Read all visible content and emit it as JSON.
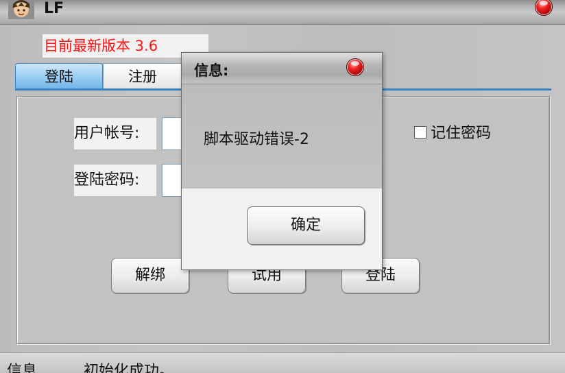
{
  "window": {
    "title": "LF",
    "logo_icon": "app-avatar-icon",
    "close_icon": "red-orb-close-icon"
  },
  "version": {
    "text": "目前最新版本 3.6",
    "color": "#ff1414"
  },
  "tabs": [
    {
      "label": "登陆",
      "active": true
    },
    {
      "label": "注册",
      "active": false
    }
  ],
  "form": {
    "account_label": "用户帐号:",
    "account_value": "",
    "password_label": "登陆密码:",
    "password_value": "",
    "remember_label": "记住密码",
    "remember_checked": false
  },
  "buttons": {
    "unbind": "解绑",
    "trial": "试用",
    "login": "登陆"
  },
  "status": {
    "key": "信息",
    "value": "初始化成功。"
  },
  "dialog": {
    "title": "信息:",
    "message": "脚本驱动错误-2",
    "ok": "确定",
    "close_icon": "red-orb-close-icon"
  },
  "colors": {
    "accent_blue": "#3b83c0",
    "window_gray": "#c2c2c2"
  }
}
